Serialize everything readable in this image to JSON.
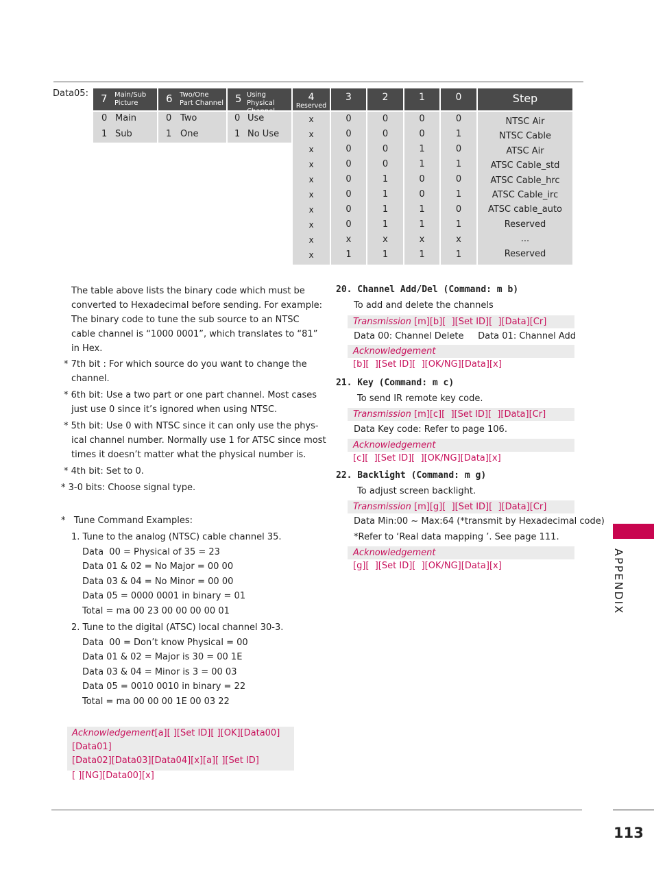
{
  "page": {
    "section_tab": "APPENDIX",
    "page_number": "113",
    "accent_color": "#c8054f",
    "header_color": "#4a4a4a"
  },
  "table": {
    "label": "Data05:",
    "bit_columns": [
      {
        "bit": "7",
        "title": "Main/Sub",
        "title2": "Picture",
        "options": [
          [
            "0",
            "Main"
          ],
          [
            "1",
            "Sub"
          ]
        ]
      },
      {
        "bit": "6",
        "title": "Two/One",
        "title2": "Part Channel",
        "options": [
          [
            "0",
            "Two"
          ],
          [
            "1",
            "One"
          ]
        ]
      },
      {
        "bit": "5",
        "title": "Using Physical",
        "title2": "Channel",
        "options": [
          [
            "0",
            "Use"
          ],
          [
            "1",
            "No Use"
          ]
        ]
      }
    ],
    "reserved": {
      "bit": "4",
      "title": "Reserved"
    },
    "signal_headers": [
      "3",
      "2",
      "1",
      "0"
    ],
    "step_header": "Step",
    "rows": [
      {
        "b4": "x",
        "b3": "0",
        "b2": "0",
        "b1": "0",
        "b0": "0",
        "step": "NTSC Air"
      },
      {
        "b4": "x",
        "b3": "0",
        "b2": "0",
        "b1": "0",
        "b0": "1",
        "step": "NTSC Cable"
      },
      {
        "b4": "x",
        "b3": "0",
        "b2": "0",
        "b1": "1",
        "b0": "0",
        "step": "ATSC Air"
      },
      {
        "b4": "x",
        "b3": "0",
        "b2": "0",
        "b1": "1",
        "b0": "1",
        "step": "ATSC Cable_std"
      },
      {
        "b4": "x",
        "b3": "0",
        "b2": "1",
        "b1": "0",
        "b0": "0",
        "step": "ATSC Cable_hrc"
      },
      {
        "b4": "x",
        "b3": "0",
        "b2": "1",
        "b1": "0",
        "b0": "1",
        "step": "ATSC Cable_irc"
      },
      {
        "b4": "x",
        "b3": "0",
        "b2": "1",
        "b1": "1",
        "b0": "0",
        "step": "ATSC cable_auto"
      },
      {
        "b4": "x",
        "b3": "0",
        "b2": "1",
        "b1": "1",
        "b0": "1",
        "step": "Reserved"
      },
      {
        "b4": "x",
        "b3": "x",
        "b2": "x",
        "b1": "x",
        "b0": "x",
        "step": "..."
      },
      {
        "b4": "x",
        "b3": "1",
        "b2": "1",
        "b1": "1",
        "b0": "1",
        "step": "Reserved"
      }
    ]
  },
  "left": {
    "intro": [
      "The table above lists the binary code which must be",
      "converted to Hexadecimal before sending. For example:",
      "The binary code to tune the sub source to an NTSC",
      "cable channel is “1000 0001”, which translates to “81”",
      "in Hex."
    ],
    "notes": [
      [
        "* 7th bit : For which source do you want to change the",
        "channel."
      ],
      [
        "* 6th bit: Use a two part or one part channel. Most cases",
        "just use 0 since it’s ignored when using NTSC."
      ],
      [
        "* 5th bit: Use 0 with NTSC since it can only use the phys-",
        "ical channel number. Normally use 1 for ATSC since most",
        "times it doesn’t  matter what the physical number is."
      ],
      [
        "* 4th bit: Set to 0."
      ],
      [
        "*  3-0 bits: Choose signal type."
      ]
    ],
    "examples_title": "*   Tune Command Examples:",
    "example1": {
      "title": "1. Tune to the analog (NTSC) cable channel 35.",
      "lines": [
        "Data  00 = Physical of 35 = 23",
        "Data 01 & 02 = No Major = 00 00",
        "Data 03 & 04 = No Minor = 00 00",
        "Data 05 = 0000 0001 in binary = 01",
        "Total = ma 00 23 00 00 00 00 01"
      ]
    },
    "example2": {
      "title": "2. Tune to the digital (ATSC) local channel 30-3.",
      "lines": [
        "Data  00 = Don’t know Physical = 00",
        "Data 01 & 02 = Major is 30 = 00 1E",
        "Data 03 & 04 = Minor is 3 = 00 03",
        "Data 05 = 0010 0010 in binary = 22",
        "Total = ma 00 00 00 1E 00 03 22"
      ]
    },
    "ack": {
      "label": "Acknowledgement",
      "line1": "[a][ ][Set ID][ ][OK][Data00][Data01]",
      "line2": "[Data02][Data03][Data04][x][a][ ][Set ID]",
      "line3": "[ ][NG][Data00][x]"
    }
  },
  "right": {
    "s20": {
      "title": "20. Channel Add/Del (Command: m b)",
      "desc": "To add and delete the channels",
      "tx_label": "Transmission",
      "tx": "[m][b][  ][Set ID][  ][Data][Cr]",
      "data": "Data 00: Channel Delete     Data 01: Channel Add",
      "ack_label": "Acknowledgement",
      "ack": "[b][  ][Set ID][  ][OK/NG][Data][x]"
    },
    "s21": {
      "title": "21. Key (Command: m c)",
      "desc": "To send IR remote key code.",
      "tx_label": "Transmission",
      "tx": "[m][c][  ][Set ID][  ][Data][Cr]",
      "data": "Data Key code: Refer to page 106.",
      "ack_label": "Acknowledgement",
      "ack": "[c][  ][Set ID][  ][OK/NG][Data][x]"
    },
    "s22": {
      "title": "22. Backlight (Command: m g)",
      "desc": "To adjust screen backlight.",
      "tx_label": "Transmission",
      "tx": "[m][g][  ][Set ID][  ][Data][Cr]",
      "data": "Data Min:00 ~ Max:64 (*transmit by Hexadecimal code)",
      "data2": "*Refer to ‘Real data mapping ’. See page 111.",
      "ack_label": "Acknowledgement",
      "ack": "[g][  ][Set ID][  ][OK/NG][Data][x]"
    }
  }
}
